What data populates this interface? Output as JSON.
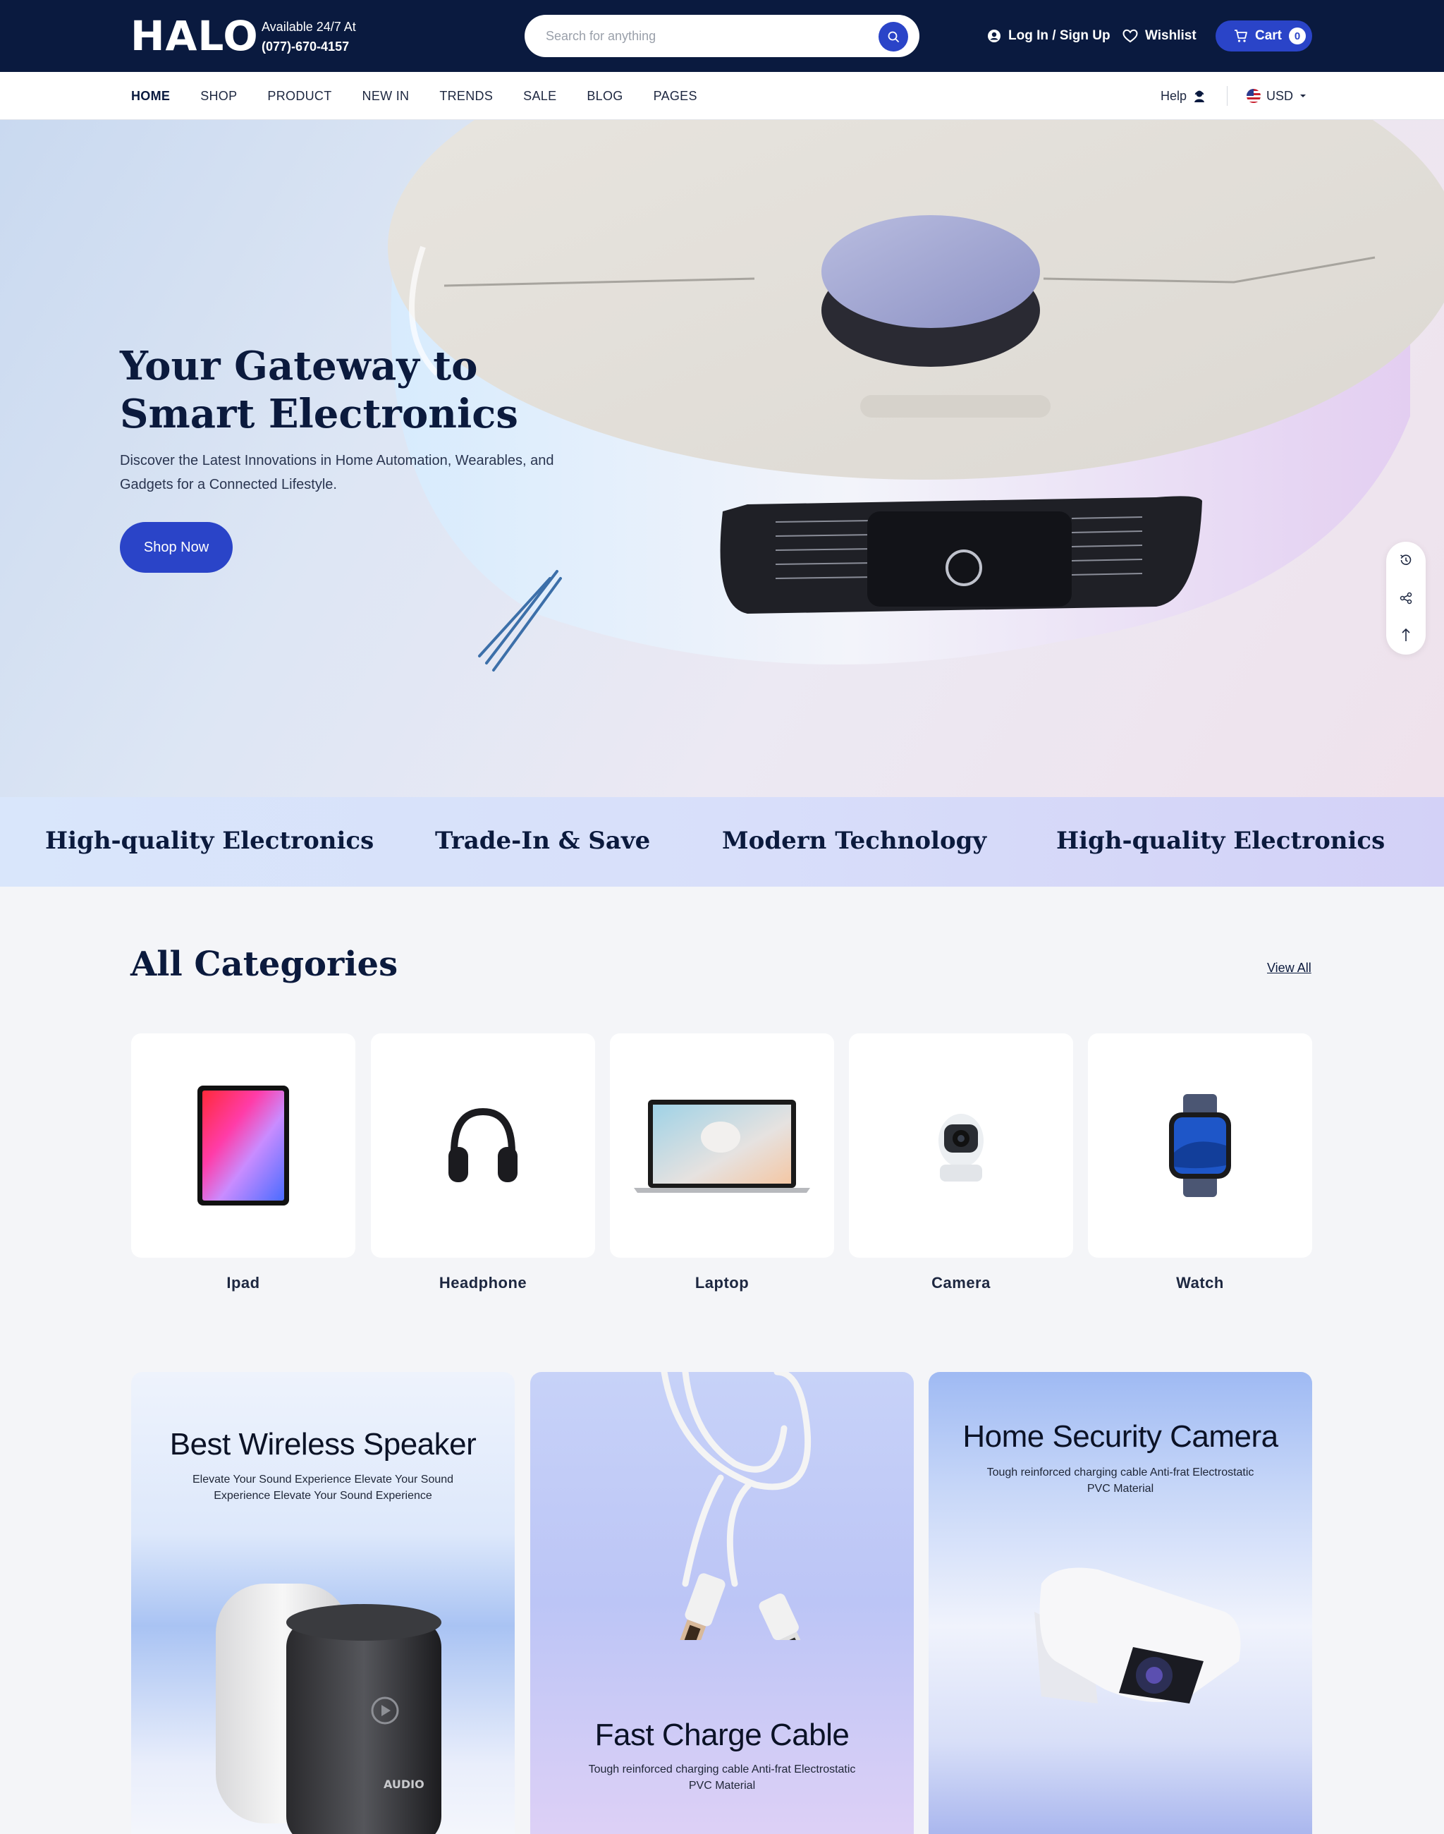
{
  "header": {
    "logo": "HALO",
    "availability": "Available 24/7 At",
    "phone": "(077)-670-4157",
    "search_placeholder": "Search for anything",
    "login": "Log In / Sign Up",
    "wishlist": "Wishlist",
    "cart_label": "Cart",
    "cart_count": "0"
  },
  "nav": {
    "items": [
      "HOME",
      "SHOP",
      "PRODUCT",
      "NEW IN",
      "TRENDS",
      "SALE",
      "BLOG",
      "PAGES"
    ],
    "active": "HOME",
    "help": "Help",
    "currency": "USD"
  },
  "hero": {
    "title": "Your Gateway to Smart Electronics",
    "subtitle": "Discover the Latest Innovations in Home Automation, Wearables, and Gadgets for a Connected Lifestyle.",
    "cta": "Shop Now"
  },
  "side_tools": [
    "history-icon",
    "share-icon",
    "back-to-top-icon"
  ],
  "marquee": [
    "High-quality Electronics",
    "Trade-In & Save",
    "Modern Technology",
    "High-quality Electronics"
  ],
  "categories": {
    "title": "All Categories",
    "view_all": "View All",
    "items": [
      {
        "label": "Ipad",
        "icon": "tablet-icon"
      },
      {
        "label": "Headphone",
        "icon": "headphone-icon"
      },
      {
        "label": "Laptop",
        "icon": "laptop-icon"
      },
      {
        "label": "Camera",
        "icon": "camera-icon"
      },
      {
        "label": "Watch",
        "icon": "watch-icon"
      }
    ]
  },
  "promos": [
    {
      "title": "Best Wireless Speaker",
      "subtitle": "Elevate Your Sound Experience Elevate Your Sound Experience Elevate Your Sound Experience",
      "product_mark": "AUDIO"
    },
    {
      "title": "Fast Charge Cable",
      "subtitle": "Tough reinforced charging cable Anti-frat Electrostatic PVC Material"
    },
    {
      "title": "Home Security Camera",
      "subtitle": "Tough reinforced charging cable Anti-frat Electrostatic PVC Material"
    }
  ],
  "colors": {
    "navy": "#0a1a3f",
    "accent_blue": "#2a44c8",
    "page_bg": "#f4f5f8"
  }
}
